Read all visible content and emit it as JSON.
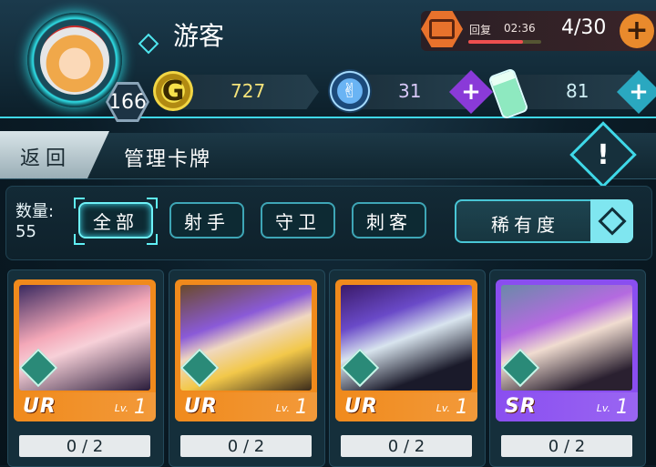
{
  "player": {
    "name": "游客",
    "level": "166"
  },
  "stamina": {
    "recover_label": "回复",
    "recover_time": "02:36",
    "value": "4/30",
    "plus": "+",
    "progress": 0.75
  },
  "currency": {
    "gold": {
      "icon": "G",
      "value": "727"
    },
    "gems": {
      "value": "31",
      "plus": "+"
    },
    "potions": {
      "value": "81",
      "plus": "+"
    }
  },
  "header": {
    "back_label": "返回",
    "title": "管理卡牌",
    "alert": "!"
  },
  "filters": {
    "count_label": "数量:",
    "count_value": "55",
    "chips": [
      "全部",
      "射手",
      "守卫",
      "刺客"
    ],
    "sort_label": "稀有度"
  },
  "cards": [
    {
      "rarity": "UR",
      "lv_label": "Lv.",
      "level": "1",
      "progress": "0 / 2",
      "frame": "#f08a1c"
    },
    {
      "rarity": "UR",
      "lv_label": "Lv.",
      "level": "1",
      "progress": "0 / 2",
      "frame": "#f08a1c"
    },
    {
      "rarity": "UR",
      "lv_label": "Lv.",
      "level": "1",
      "progress": "0 / 2",
      "frame": "#f08a1c"
    },
    {
      "rarity": "SR",
      "lv_label": "Lv.",
      "level": "1",
      "progress": "0 / 2",
      "frame": "#8a4ef0"
    }
  ]
}
